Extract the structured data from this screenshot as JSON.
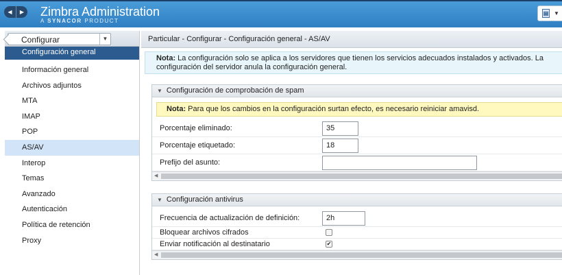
{
  "header": {
    "title": "Zimbra Administration",
    "subtitle_prefix": "A ",
    "subtitle_brand": "SYNACOR",
    "subtitle_suffix": " PRODUCT",
    "back_icon": "back-arrow-icon",
    "forward_icon": "forward-arrow-icon",
    "help_icon": "help-doc-icon"
  },
  "sidebar": {
    "crumb_label": "Configurar",
    "items": [
      {
        "label": "Configuración general"
      },
      {
        "label": "Información general"
      },
      {
        "label": "Archivos adjuntos"
      },
      {
        "label": "MTA"
      },
      {
        "label": "IMAP"
      },
      {
        "label": "POP"
      },
      {
        "label": "AS/AV"
      },
      {
        "label": "Interop"
      },
      {
        "label": "Temas"
      },
      {
        "label": "Avanzado"
      },
      {
        "label": "Autenticación"
      },
      {
        "label": "Política de retención"
      },
      {
        "label": "Proxy"
      }
    ]
  },
  "main": {
    "breadcrumb": "Particular - Configurar - Configuración general - AS/AV",
    "note_label": "Nota:",
    "note_text": " La configuración solo se aplica a los servidores que tienen los servicios adecuados instalados y activados. La configuración del servidor anula la configuración general.",
    "spam": {
      "title": "Configuración de comprobación de spam",
      "warn_label": "Nota:",
      "warn_text": " Para que los cambios en la configuración surtan efecto, es necesario reiniciar amavisd.",
      "kill_label": "Porcentaje eliminado:",
      "kill_value": "35",
      "tag_label": "Porcentaje etiquetado:",
      "tag_value": "18",
      "subject_label": "Prefijo del asunto:",
      "subject_value": ""
    },
    "antivirus": {
      "title": "Configuración antivirus",
      "freq_label": "Frecuencia de actualización de definición:",
      "freq_value": "2h",
      "block_label": "Bloquear archivos cifrados",
      "block_checked": false,
      "notify_label": "Enviar notificación al destinatario",
      "notify_checked": true
    }
  }
}
